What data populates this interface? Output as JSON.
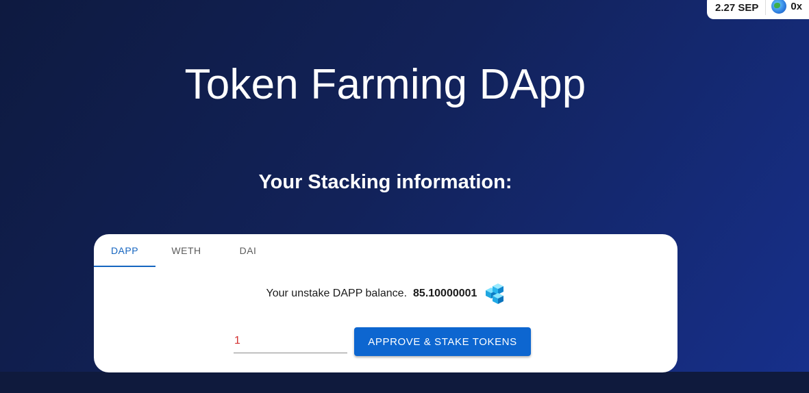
{
  "wallet": {
    "balance": "2.27 SEP",
    "address": "0x",
    "account_icon": "globe-icon"
  },
  "header": {
    "title": "Token Farming DApp"
  },
  "staking": {
    "heading": "Your Stacking information:",
    "tabs": [
      {
        "label": "DAPP",
        "active": true
      },
      {
        "label": "WETH",
        "active": false
      },
      {
        "label": "DAI",
        "active": false
      }
    ],
    "balance_label": "Your unstake DAPP balance.",
    "balance_value": "85.10000001",
    "token_icon": "dapp-token-icon",
    "amount_value": "1",
    "stake_button_label": "APPROVE & STAKE TOKENS"
  },
  "colors": {
    "accent": "#0d66d0",
    "active_tab": "#1565c0",
    "input_text": "#d32f2f"
  }
}
